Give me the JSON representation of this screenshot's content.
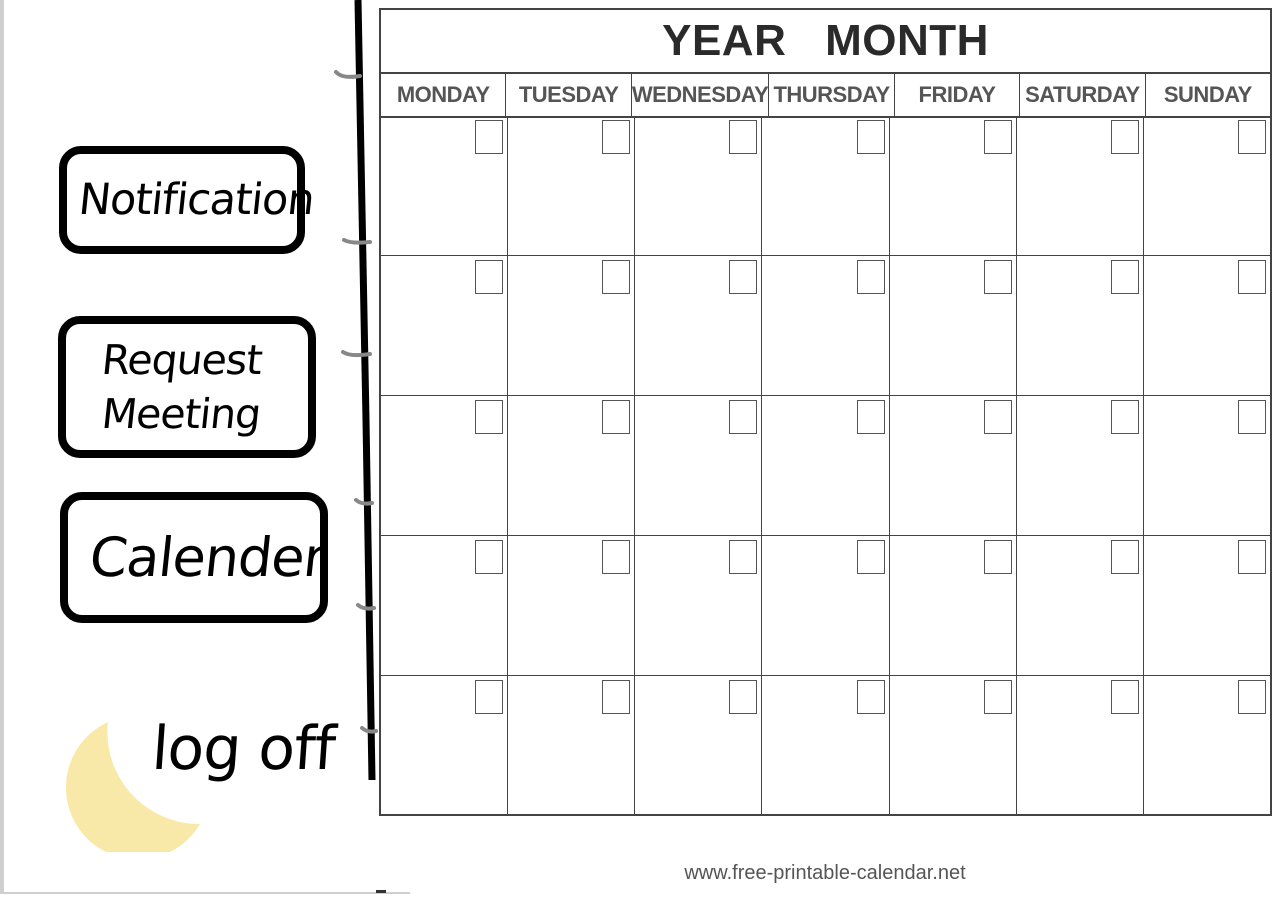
{
  "sidebar": {
    "notification_label": "Notification",
    "request_meeting_line1": "Request",
    "request_meeting_line2": "Meeting",
    "calendar_label": "Calender",
    "logoff_label": "log off",
    "moon_color": "#f9e9a8"
  },
  "calendar": {
    "title": "YEAR MONTH",
    "days": [
      "MONDAY",
      "TUESDAY",
      "WEDNESDAY",
      "THURSDAY",
      "FRIDAY",
      "SATURDAY",
      "SUNDAY"
    ],
    "weeks": 5,
    "footer": "www.free-printable-calendar.net"
  }
}
